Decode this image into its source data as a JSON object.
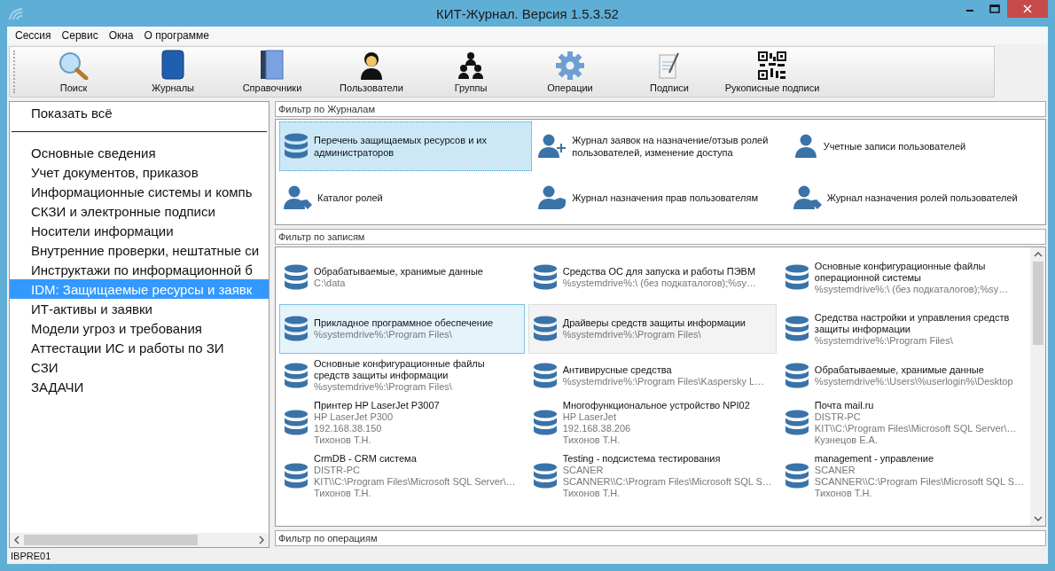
{
  "window": {
    "title": "КИТ-Журнал. Версия 1.5.3.52"
  },
  "menu": [
    "Сессия",
    "Сервис",
    "Окна",
    "О программе"
  ],
  "toolbar": [
    {
      "label": "Поиск",
      "kind": "search"
    },
    {
      "label": "Журналы",
      "kind": "book"
    },
    {
      "label": "Справочники",
      "kind": "directory"
    },
    {
      "label": "Пользователи",
      "kind": "user"
    },
    {
      "label": "Группы",
      "kind": "group"
    },
    {
      "label": "Операции",
      "kind": "gear"
    },
    {
      "label": "Подписи",
      "kind": "signature"
    },
    {
      "label": "Рукописные подписи",
      "kind": "qr"
    }
  ],
  "sidebar": {
    "show_all": "Показать всё",
    "items": [
      {
        "label": "Основные сведения",
        "selected": false
      },
      {
        "label": "Учет документов, приказов",
        "selected": false
      },
      {
        "label": "Информационные системы и компь",
        "selected": false
      },
      {
        "label": "СКЗИ и электронные подписи",
        "selected": false
      },
      {
        "label": "Носители информации",
        "selected": false
      },
      {
        "label": "Внутренние проверки, нештатные си",
        "selected": false
      },
      {
        "label": "Инструктажи по информационной б",
        "selected": false
      },
      {
        "label": "IDM: Защищаемые ресурсы  и заявк",
        "selected": true
      },
      {
        "label": "ИТ-активы и заявки",
        "selected": false
      },
      {
        "label": "Модели угроз и требования",
        "selected": false
      },
      {
        "label": "Аттестации ИС и работы по ЗИ",
        "selected": false
      },
      {
        "label": "СЗИ",
        "selected": false
      },
      {
        "label": "ЗАДАЧИ",
        "selected": false
      }
    ]
  },
  "journal_filter": {
    "title": "Фильтр по Журналам",
    "items": [
      {
        "label": "Перечень защищаемых ресурсов и их администраторов",
        "kind": "database",
        "selected": true
      },
      {
        "label": "Журнал заявок на назначение/отзыв ролей пользователей, изменение доступа",
        "kind": "user-add",
        "selected": false
      },
      {
        "label": "Учетные записи пользователей",
        "kind": "user",
        "selected": false
      },
      {
        "label": "Каталог ролей",
        "kind": "user-tag",
        "selected": false
      },
      {
        "label": "Журнал назначения прав пользователям",
        "kind": "user-shield",
        "selected": false
      },
      {
        "label": "Журнал назначения ролей пользователей",
        "kind": "user-tag",
        "selected": false
      }
    ]
  },
  "record_filter": {
    "title": "Фильтр по записям",
    "items": [
      {
        "title": "Обрабатываемые, хранимые данные",
        "details": [
          "C:\\data"
        ],
        "selected": false,
        "hovered": false
      },
      {
        "title": "Средства ОС для запуска и работы ПЭВМ",
        "details": [
          "%systemdrive%:\\ (без подкаталогов);%sy…"
        ],
        "selected": false,
        "hovered": false
      },
      {
        "title": "Основные конфигурационные файлы операционной системы",
        "details": [
          "%systemdrive%:\\ (без подкаталогов);%sy…"
        ],
        "selected": false,
        "hovered": false
      },
      {
        "title": "Прикладное программное обеспечение",
        "details": [
          "%systemdrive%:\\Program Files\\"
        ],
        "selected": true,
        "hovered": false
      },
      {
        "title": "Драйверы средств защиты информации",
        "details": [
          "%systemdrive%:\\Program Files\\"
        ],
        "selected": false,
        "hovered": true
      },
      {
        "title": "Средства настройки и управления средств защиты информации",
        "details": [
          "%systemdrive%:\\Program Files\\"
        ],
        "selected": false,
        "hovered": false
      },
      {
        "title": "Основные конфигурационные файлы средств защиты информации",
        "details": [
          "%systemdrive%:\\Program Files\\"
        ],
        "selected": false,
        "hovered": false
      },
      {
        "title": "Антивирусные средства",
        "details": [
          "%systemdrive%:\\Program Files\\Kaspersky L…"
        ],
        "selected": false,
        "hovered": false
      },
      {
        "title": "Обрабатываемые, хранимые данные",
        "details": [
          "%systemdrive%:\\Users\\%userlogin%\\Desktop"
        ],
        "selected": false,
        "hovered": false
      },
      {
        "title": "Принтер HP LaserJet P3007",
        "details": [
          "HP LaserJet P300",
          "192.168.38.150",
          "Тихонов Т.Н."
        ],
        "selected": false,
        "hovered": false
      },
      {
        "title": "Многофункциональное устройство NPI02",
        "details": [
          "HP LaserJet",
          "192.168.38.206",
          "Тихонов Т.Н."
        ],
        "selected": false,
        "hovered": false
      },
      {
        "title": "Почта mail.ru",
        "details": [
          "DISTR-PC",
          "KIT\\\\C:\\Program Files\\Microsoft SQL Server\\…",
          "Кузнецов Е.А."
        ],
        "selected": false,
        "hovered": false
      },
      {
        "title": "CrmDB - CRM система",
        "details": [
          "DISTR-PC",
          "KIT\\\\C:\\Program Files\\Microsoft SQL Server\\…",
          "Тихонов Т.Н."
        ],
        "selected": false,
        "hovered": false
      },
      {
        "title": "Testing - подсистема тестирования",
        "details": [
          "SCANER",
          "SCANNER\\\\C:\\Program Files\\Microsoft SQL S…",
          "Тихонов Т.Н."
        ],
        "selected": false,
        "hovered": false
      },
      {
        "title": "management - управление",
        "details": [
          "SCANER",
          "SCANNER\\\\C:\\Program Files\\Microsoft SQL S…",
          "Тихонов Т.Н."
        ],
        "selected": false,
        "hovered": false
      }
    ]
  },
  "operation_filter": {
    "title": "Фильтр по операциям"
  },
  "status_bar": {
    "text": "IBPRE01"
  }
}
